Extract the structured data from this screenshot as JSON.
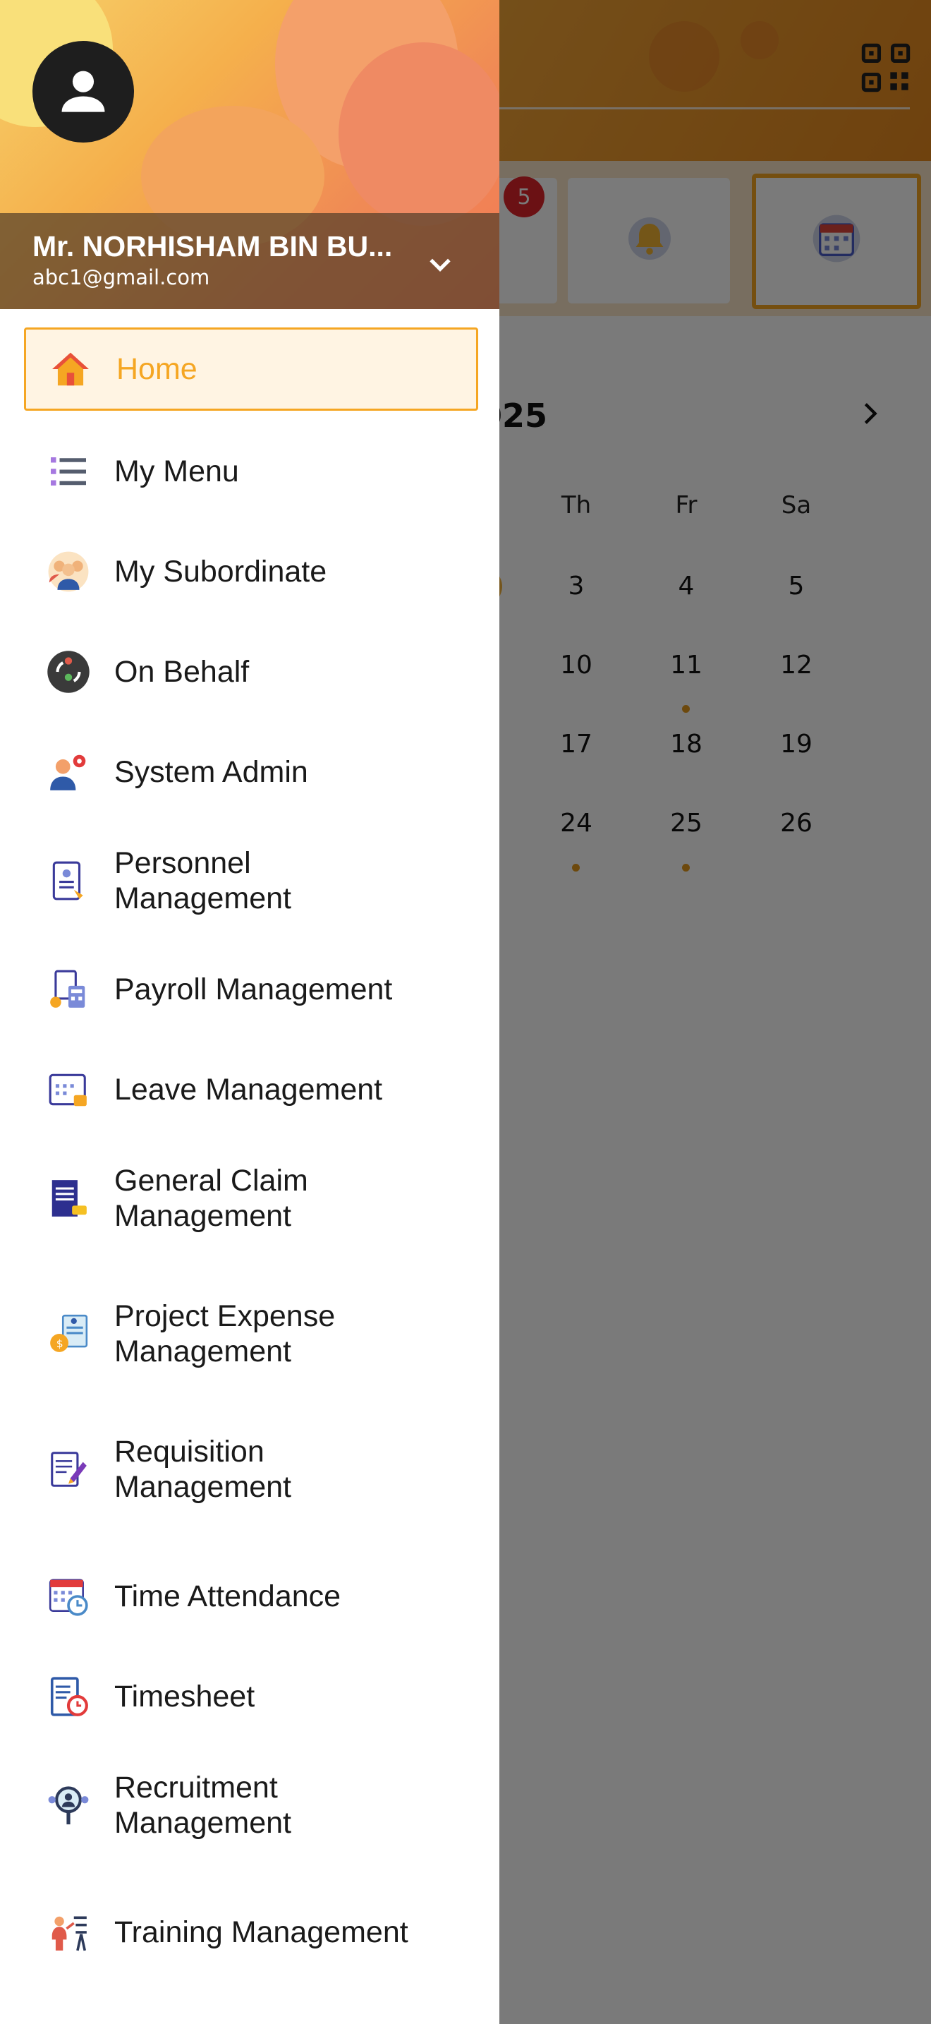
{
  "background": {
    "notification_count": "5",
    "calendar": {
      "month_title_fragment": "025",
      "weekdays": [
        "Th",
        "Fr",
        "Sa"
      ],
      "weeks": [
        [
          "3",
          "4",
          "5"
        ],
        [
          "10",
          "11",
          "12"
        ],
        [
          "17",
          "18",
          "19"
        ],
        [
          "24",
          "25",
          "26"
        ]
      ]
    }
  },
  "drawer": {
    "user": {
      "name": "Mr. NORHISHAM BIN BU...",
      "email": "abc1@gmail.com"
    },
    "items": [
      {
        "label": "Home",
        "icon": "home-icon",
        "active": true
      },
      {
        "label": "My Menu",
        "icon": "list-icon"
      },
      {
        "label": "My Subordinate",
        "icon": "team-icon"
      },
      {
        "label": "On Behalf",
        "icon": "swap-user-icon"
      },
      {
        "label": "System Admin",
        "icon": "admin-gear-icon"
      },
      {
        "label": "Personnel Management",
        "icon": "id-card-icon"
      },
      {
        "label": "Payroll Management",
        "icon": "payroll-calculator-icon"
      },
      {
        "label": "Leave Management",
        "icon": "calendar-leave-icon"
      },
      {
        "label": "General Claim Management",
        "icon": "claim-document-icon"
      },
      {
        "label": "Project Expense Management",
        "icon": "expense-money-bag-icon"
      },
      {
        "label": "Requisition Management",
        "icon": "requisition-pen-icon"
      },
      {
        "label": "Time Attendance",
        "icon": "calendar-clock-icon"
      },
      {
        "label": "Timesheet",
        "icon": "timesheet-clock-icon"
      },
      {
        "label": "Recruitment Management",
        "icon": "recruitment-search-icon"
      },
      {
        "label": "Training Management",
        "icon": "training-board-icon"
      }
    ]
  }
}
